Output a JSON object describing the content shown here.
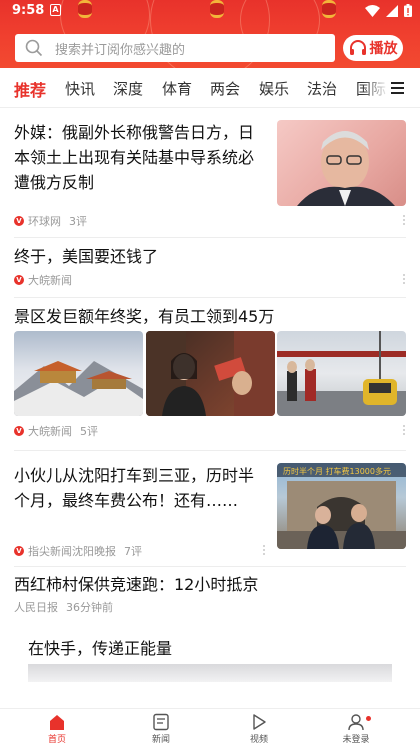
{
  "status_bar": {
    "time": "9:58",
    "notice_letter": "A"
  },
  "search": {
    "placeholder": "搜索并订阅你感兴趣的"
  },
  "play_button": {
    "label": "播放"
  },
  "tabs": [
    "推荐",
    "快讯",
    "深度",
    "体育",
    "两会",
    "娱乐",
    "法治",
    "国际"
  ],
  "feed": [
    {
      "title": "外媒：俄副外长称俄警告日方，日本领土上出现有关陆基中导系统必遭俄方反制",
      "source": "环球网",
      "comments": "3评",
      "image": "official-portrait"
    },
    {
      "title": "终于，美国要还钱了",
      "source": "大皖新闻"
    },
    {
      "title": "景区发巨额年终奖，有员工领到45万",
      "source": "大皖新闻",
      "comments": "5评",
      "images": [
        "mountain-temple-snow",
        "woman-receiving-cash",
        "scenic-gondola"
      ]
    },
    {
      "title": "小伙儿从沈阳打车到三亚，历时半个月，最终车费公布！还有……",
      "source": "指尖新闻沈阳晚报",
      "comments": "7评",
      "image": "men-at-city-gate"
    },
    {
      "title": "西红柿村保供竞速跑：12小时抵京",
      "source": "人民日报",
      "time_ago": "36分钟前"
    },
    {
      "title": "在快手，传递正能量",
      "caption": ""
    }
  ],
  "bottom_nav": [
    {
      "label": "首页",
      "icon": "home-icon",
      "active": true
    },
    {
      "label": "新闻",
      "icon": "news-icon"
    },
    {
      "label": "视频",
      "icon": "video-icon"
    },
    {
      "label": "未登录",
      "icon": "user-icon",
      "badge": true
    }
  ],
  "colors": {
    "accent": "#e8322b",
    "header_bg": "#f0402f",
    "meta_text": "#999999"
  }
}
